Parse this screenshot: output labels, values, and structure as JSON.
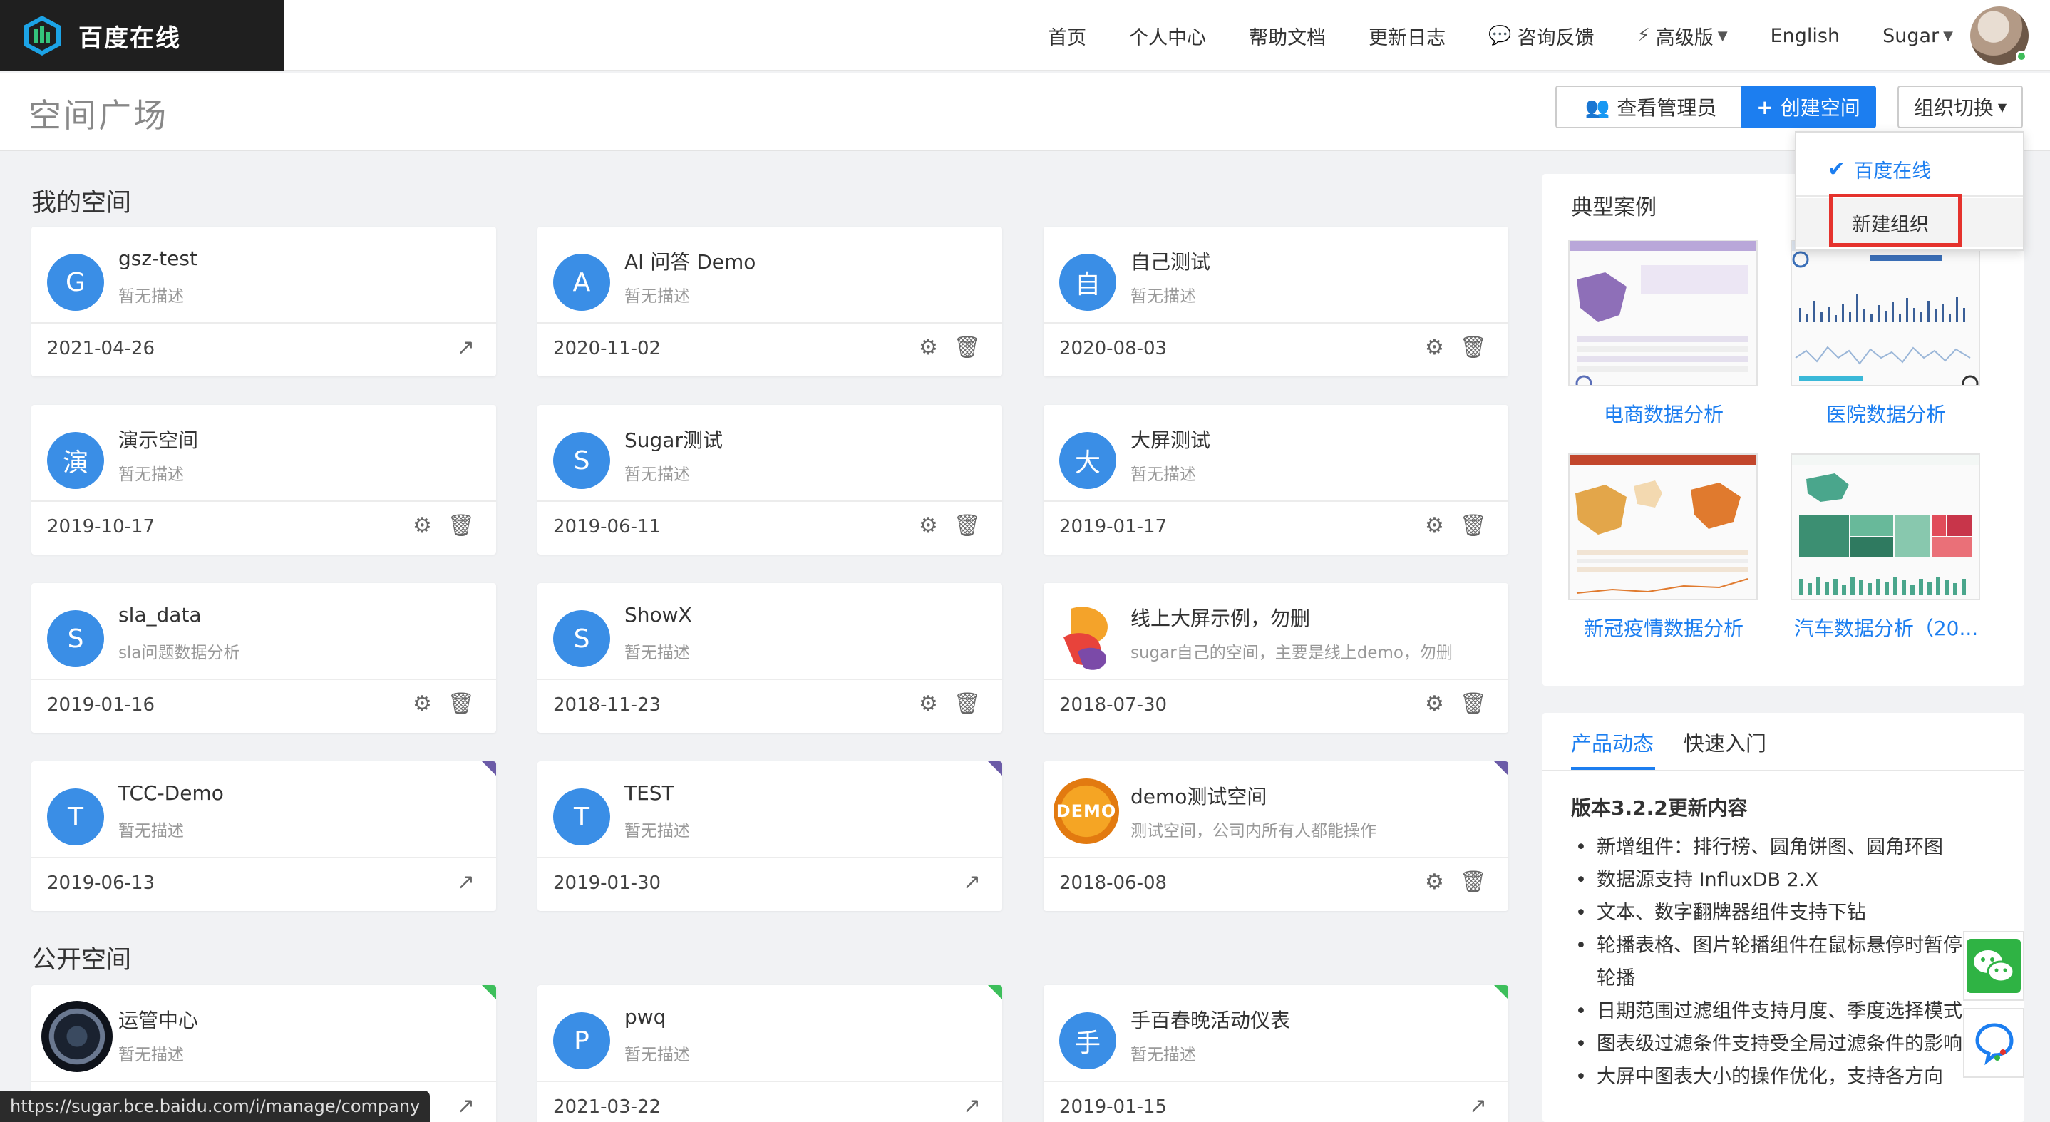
{
  "brand": {
    "name": "百度在线"
  },
  "nav": {
    "home": "首页",
    "profile": "个人中心",
    "help": "帮助文档",
    "changelog": "更新日志",
    "feedback": "咨询反馈",
    "advanced": "高级版",
    "language": "English",
    "user": "Sugar"
  },
  "header": {
    "title": "空间广场",
    "view_admin": "查看管理员",
    "create_space": "创建空间",
    "org_switch": "组织切换"
  },
  "org_dropdown": {
    "current": "百度在线",
    "new_org": "新建组织"
  },
  "my_spaces_title": "我的空间",
  "public_spaces_title": "公开空间",
  "my_spaces": [
    {
      "avatar": "G",
      "name": "gsz-test",
      "desc": "暂无描述",
      "date": "2021-04-26",
      "actions": "share"
    },
    {
      "avatar": "A",
      "name": "AI 问答 Demo",
      "desc": "暂无描述",
      "date": "2020-11-02",
      "actions": "manage"
    },
    {
      "avatar": "自",
      "name": "自己测试",
      "desc": "暂无描述",
      "date": "2020-08-03",
      "actions": "manage"
    },
    {
      "avatar": "演",
      "name": "演示空间",
      "desc": "暂无描述",
      "date": "2019-10-17",
      "actions": "manage"
    },
    {
      "avatar": "S",
      "name": "Sugar测试",
      "desc": "暂无描述",
      "date": "2019-06-11",
      "actions": "manage"
    },
    {
      "avatar": "大",
      "name": "大屏测试",
      "desc": "暂无描述",
      "date": "2019-01-17",
      "actions": "manage"
    },
    {
      "avatar": "S",
      "name": "sla_data",
      "desc": "sla问题数据分析",
      "date": "2019-01-16",
      "actions": "manage"
    },
    {
      "avatar": "S",
      "name": "ShowX",
      "desc": "暂无描述",
      "date": "2018-11-23",
      "actions": "manage"
    },
    {
      "avatar": "logo",
      "name": "线上大屏示例，勿删",
      "desc": "sugar自己的空间，主要是线上demo，勿删",
      "date": "2018-07-30",
      "actions": "manage"
    },
    {
      "avatar": "T",
      "name": "TCC-Demo",
      "desc": "暂无描述",
      "date": "2019-06-13",
      "actions": "share",
      "corner": "purple"
    },
    {
      "avatar": "T",
      "name": "TEST",
      "desc": "暂无描述",
      "date": "2019-01-30",
      "actions": "share",
      "corner": "purple"
    },
    {
      "avatar": "demo",
      "avatar_text": "DEMO",
      "name": "demo测试空间",
      "desc": "测试空间，公司内所有人都能操作",
      "date": "2018-06-08",
      "actions": "manage",
      "corner": "purple"
    }
  ],
  "public_spaces": [
    {
      "avatar": "photo",
      "name": "运管中心",
      "desc": "暂无描述",
      "date": "",
      "actions": "share",
      "corner": "green"
    },
    {
      "avatar": "P",
      "name": "pwq",
      "desc": "暂无描述",
      "date": "2021-03-22",
      "actions": "share",
      "corner": "green"
    },
    {
      "avatar": "手",
      "name": "手百春晚活动仪表",
      "desc": "暂无描述",
      "date": "2019-01-15",
      "actions": "share",
      "corner": "green"
    }
  ],
  "cases": {
    "title": "典型案例",
    "items": [
      {
        "label": "电商数据分析"
      },
      {
        "label": "医院数据分析"
      },
      {
        "label": "新冠疫情数据分析"
      },
      {
        "label": "汽车数据分析（20..."
      }
    ]
  },
  "news": {
    "tabs": [
      "产品动态",
      "快速入门"
    ],
    "title": "版本3.2.2更新内容",
    "items": [
      "新增组件：排行榜、圆角饼图、圆角环图",
      "数据源支持 InfluxDB 2.X",
      "文本、数字翻牌器组件支持下钻",
      "轮播表格、图片轮播组件在鼠标悬停时暂停",
      "轮播",
      "日期范围过滤组件支持月度、季度选择模式",
      "图表级过滤条件支持受全局过滤条件的影响",
      "大屏中图表大小的操作优化，支持各方向"
    ]
  },
  "status_url": "https://sugar.bce.baidu.com/i/manage/company",
  "colors": {
    "primary": "#1c7ef0",
    "avatar": "#3a8ee6",
    "highlight": "#e5322d"
  }
}
